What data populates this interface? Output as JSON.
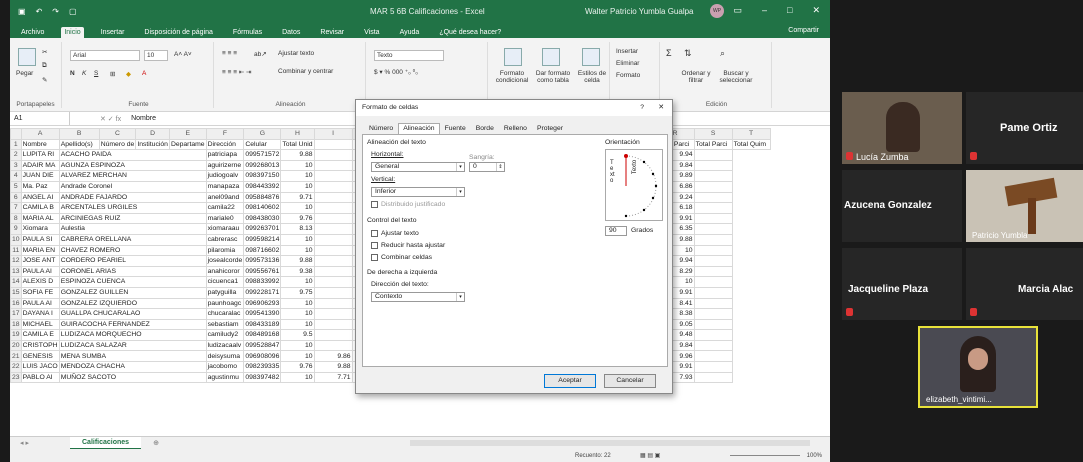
{
  "excel": {
    "title": {
      "doc": "MAR 5 6B Calificaciones - Excel",
      "user": "Walter Patricio Yumbla Gualpa",
      "avatar": "WP",
      "quick_access": [
        "save-icon",
        "undo-icon",
        "redo-icon",
        "file-icon"
      ]
    },
    "tabs": [
      "Archivo",
      "Inicio",
      "Insertar",
      "Disposición de página",
      "Fórmulas",
      "Datos",
      "Revisar",
      "Vista",
      "Ayuda",
      "¿Qué desea hacer?"
    ],
    "share": "Compartir",
    "ribbon": {
      "paste": "Pegar",
      "font_name": "Arial",
      "font_size": "10",
      "wrap": "Ajustar texto",
      "merge": "Combinar y centrar",
      "num_format": "Texto",
      "cond": "Formato condicional",
      "table": "Dar formato como tabla",
      "cell_styles": "Estilos de celda",
      "insert": "Insertar",
      "delete": "Eliminar",
      "format": "Formato",
      "sort": "Ordenar y filtrar",
      "find": "Buscar y seleccionar",
      "groups": [
        "Portapapeles",
        "Fuente",
        "Alineación",
        "Edición"
      ]
    },
    "namebox": "A1",
    "formula": "Nombre",
    "col_headers": [
      "",
      "A",
      "B",
      "C",
      "D",
      "E",
      "F",
      "G",
      "H",
      "I",
      "J",
      "K",
      "L",
      "M",
      "N",
      "O",
      "P",
      "Q",
      "R",
      "S",
      "T"
    ],
    "header_row": [
      "Nombre",
      "Apellido(s)",
      "Número de",
      "Institución",
      "Departame",
      "Dirección",
      "Celular",
      "Total Unid",
      "",
      "",
      "",
      "",
      "",
      "",
      "",
      "",
      "",
      "",
      "Total Parci",
      "Total Parci",
      "Total Quim",
      "Total"
    ],
    "rows": [
      {
        "n": "2",
        "a": "LUPITA RI",
        "b": "ACACHO PAIDA",
        "f": "patriciapa",
        "g": "099571572",
        "h": "9.88",
        "r": "10",
        "s": "9.94"
      },
      {
        "n": "3",
        "a": "ADAIR MA",
        "b": "AGUNZA ESPINOZA",
        "f": "aguirizerne",
        "g": "099268013",
        "h": "10",
        "r": "10",
        "s": "9.84"
      },
      {
        "n": "4",
        "a": "JUAN DIE",
        "b": "ALVAREZ MERCHAN",
        "f": "judiogoalv",
        "g": "098397150",
        "h": "10",
        "r": "10",
        "s": "9.89"
      },
      {
        "n": "5",
        "a": "Ma. Paz",
        "b": "Andrade Coronel",
        "f": "manapaza",
        "g": "098443392",
        "h": "10",
        "r": "6.4",
        "s": "6.86"
      },
      {
        "n": "6",
        "a": "ANGEL AI",
        "b": "ANDRADE FAJARDO",
        "f": "anel09and",
        "g": "095884876",
        "h": "9.71",
        "r": "9",
        "s": "9.24"
      },
      {
        "n": "7",
        "a": "CAMILA B",
        "b": "ARCENTALES URGILES",
        "f": "camila22",
        "g": "098140602",
        "h": "10",
        "r": "4.6",
        "s": "6.18"
      },
      {
        "n": "8",
        "a": "MARIA AL",
        "b": "ARCINIEGAS RUIZ",
        "f": "mariale0",
        "g": "098438030",
        "h": "9.76",
        "r": "10",
        "s": "9.91"
      },
      {
        "n": "9",
        "a": "Xiomara",
        "b": "Aulestia",
        "f": "xiomaraau",
        "g": "099263701",
        "h": "8.13",
        "r": "7.8",
        "s": "6.35"
      },
      {
        "n": "10",
        "a": "PAULA SI",
        "b": "CABRERA ORELLANA",
        "f": "cabrerasc",
        "g": "099598214",
        "h": "10",
        "r": "10",
        "s": "9.88"
      },
      {
        "n": "11",
        "a": "MARIA EN",
        "b": "CHAVEZ ROMERO",
        "f": "pilaromia",
        "g": "098716602",
        "h": "10",
        "r": "10",
        "s": "10"
      },
      {
        "n": "12",
        "a": "JOSE ANT",
        "b": "CORDERO PEARIEL",
        "f": "josealcorde",
        "g": "099573136",
        "h": "9.88",
        "r": "10",
        "s": "9.94"
      },
      {
        "n": "13",
        "a": "PAULA AI",
        "b": "CORONEL ARIAS",
        "f": "anahicoror",
        "g": "099556761",
        "h": "9.38",
        "r": "9.6",
        "s": "8.29"
      },
      {
        "n": "14",
        "a": "ALEXIS D",
        "b": "ESPINOZA CUENCA",
        "f": "cicuenca1",
        "g": "098833992",
        "h": "10",
        "r": "10",
        "s": "10"
      },
      {
        "n": "15",
        "a": "SOFIA FE",
        "b": "GONZALEZ GUILLEN",
        "f": "patyguilla",
        "g": "099228171",
        "h": "9.75",
        "r": "10",
        "s": "9.91"
      },
      {
        "n": "16",
        "a": "PAULA AI",
        "b": "GONZALEZ IZQUIERDO",
        "f": "paunhoagc",
        "g": "096906293",
        "h": "10",
        "r": "8.2",
        "s": "8.41"
      },
      {
        "n": "17",
        "a": "DAYANA I",
        "b": "GUALLPA CHUCARALAO",
        "f": "chucaralac",
        "g": "099541390",
        "h": "10",
        "r": "8.2",
        "s": "8.38"
      },
      {
        "n": "18",
        "a": "MICHAEL",
        "b": "GUIRACOCHA FERNANDEZ",
        "f": "sebastiam",
        "g": "098433189",
        "h": "10",
        "r": "9.6",
        "s": "9.05"
      },
      {
        "n": "19",
        "a": "CAMILA E",
        "b": "LUDIZACA MORQUECHO",
        "f": "camiludy2",
        "g": "098489168",
        "h": "9.5",
        "r": "10",
        "s": "9.48"
      },
      {
        "n": "20",
        "a": "CRISTOPH",
        "b": "LUDIZACA SALAZAR",
        "f": "ludizacaalv",
        "g": "099528847",
        "h": "10",
        "r": "9.8",
        "s": "9.84"
      },
      {
        "n": "21",
        "a": "GENESIS",
        "b": "MENA SUMBA",
        "f": "deisysuma",
        "g": "096908096",
        "h": "10",
        "i": "9.86",
        "j": "9.93",
        "k": "10",
        "r": "10",
        "s": "9.96"
      },
      {
        "n": "22",
        "a": "LUIS JACO",
        "b": "MENDOZA CHACHA",
        "f": "jacobomo",
        "g": "098239335",
        "h": "9.76",
        "i": "9.88",
        "j": "9.81",
        "k": "10",
        "r": "10",
        "s": "9.91"
      },
      {
        "n": "23",
        "a": "PABLO AI",
        "b": "MUÑOZ SACOTO",
        "f": "agustinmu",
        "g": "098397482",
        "h": "10",
        "i": "7.71",
        "j": "8.86",
        "k": "7",
        "r": "7",
        "s": "7.93"
      }
    ],
    "sheet_tab": "Calificaciones",
    "status": {
      "count": "Recuento: 22",
      "zoom": "100%"
    }
  },
  "dialog": {
    "title": "Formato de celdas",
    "help": "?",
    "close": "✕",
    "tabs": [
      "Número",
      "Alineación",
      "Fuente",
      "Borde",
      "Relleno",
      "Proteger"
    ],
    "align_section": "Alineación del texto",
    "horizontal_label": "Horizontal:",
    "horizontal_value": "General",
    "indent_label": "Sangría:",
    "indent_value": "0",
    "vertical_label": "Vertical:",
    "vertical_value": "Inferior",
    "distributed": "Distribuido justificado",
    "control_section": "Control del texto",
    "wrap": "Ajustar texto",
    "shrink": "Reducir hasta ajustar",
    "merge": "Combinar celdas",
    "rtl_section": "De derecha a izquierda",
    "direction_label": "Dirección del texto:",
    "direction_value": "Contexto",
    "orientation_label": "Orientación",
    "orientation_text": "Texto",
    "degrees_value": "90",
    "degrees_label": "Grados",
    "ok": "Aceptar",
    "cancel": "Cancelar"
  },
  "zoom": {
    "participants": [
      {
        "name": "Lucía Zumba",
        "video": true
      },
      {
        "name": "Pame Ortiz",
        "video": false
      },
      {
        "name": "Azucena Gonzalez",
        "video": false
      },
      {
        "name": "Patricio Yumbla",
        "video": true
      },
      {
        "name": "Jacqueline Plaza",
        "video": false
      },
      {
        "name": "Marcia Alac",
        "video": false
      },
      {
        "name": "elizabeth_vintimi...",
        "video": true
      }
    ],
    "active_speaker_color": "#e8e23a",
    "muted_color": "#d33"
  }
}
